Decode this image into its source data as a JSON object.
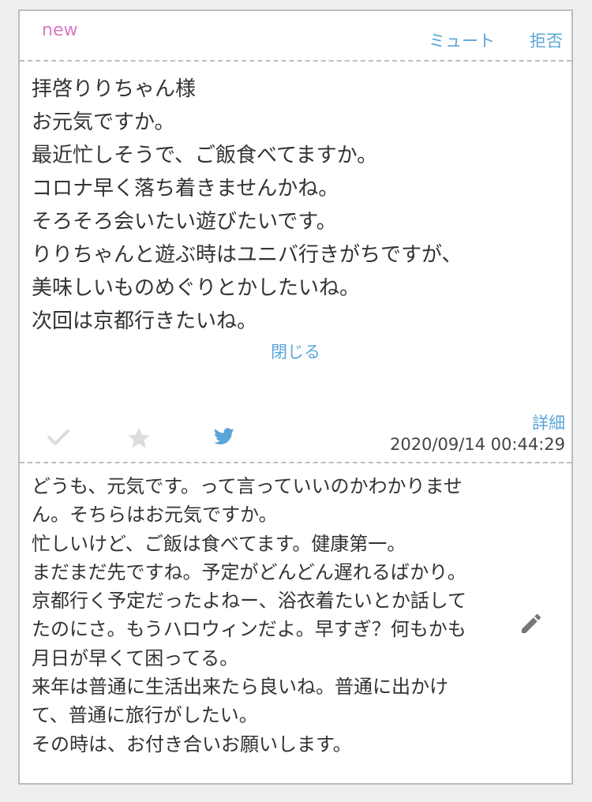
{
  "card": {
    "badge": "new",
    "mute_label": "ミュート",
    "reject_label": "拒否",
    "message": "拝啓りりちゃん様\nお元気ですか。\n最近忙しそうで、ご飯食べてますか。\nコロナ早く落ち着きませんかね。\nそろそろ会いたい遊びたいです。\nりりちゃんと遊ぶ時はユニバ行きがちですが、\n美味しいものめぐりとかしたいね。\n次回は京都行きたいね。",
    "close_label": "閉じる",
    "detail_label": "詳細",
    "timestamp": "2020/09/14 00:44:29",
    "reply": "どうも、元気です。って言っていいのかわかりません。そちらはお元気ですか。\n忙しいけど、ご飯は食べてます。健康第一。\nまだまだ先ですね。予定がどんどん遅れるばかり。京都行く予定だったよねー、浴衣着たいとか話してたのにさ。もうハロウィンだよ。早すぎ？何もかも月日が早くて困ってる。\n来年は普通に生活出来たら良いね。普通に出かけて、普通に旅行がしたい。\nその時は、お付き合いお願いします。"
  },
  "icons": {
    "check": "check-icon",
    "star": "star-icon",
    "twitter": "twitter-icon",
    "edit": "pencil-icon"
  },
  "colors": {
    "accent": "#5aa6d8",
    "new_badge": "#d77bc4",
    "icon_gray": "#dcdcdc",
    "twitter": "#5aa6d8",
    "edit": "#777777"
  }
}
